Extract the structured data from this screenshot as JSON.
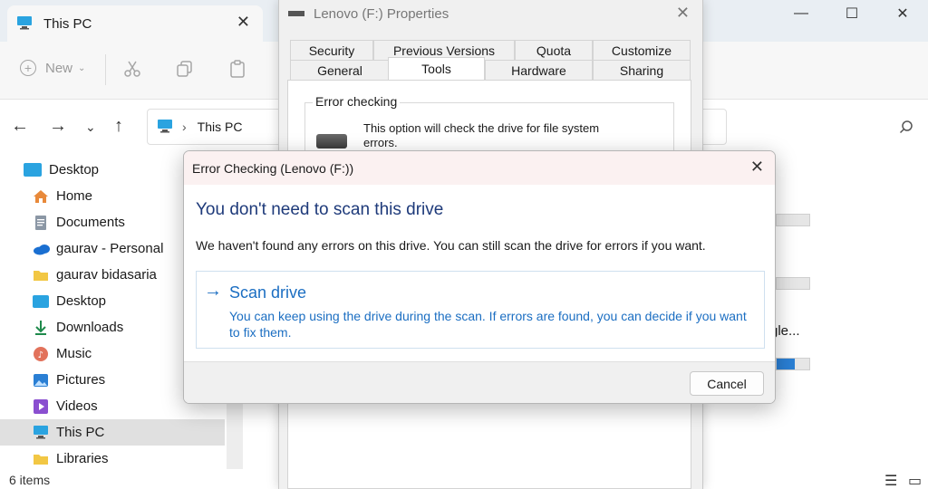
{
  "explorer": {
    "tab_title": "This PC",
    "toolbar": {
      "new_label": "New"
    },
    "breadcrumb": [
      "This PC"
    ],
    "sidebar": [
      {
        "label": "Desktop",
        "icon": "desktop-icon"
      },
      {
        "label": "Home",
        "icon": "home-icon"
      },
      {
        "label": "Documents",
        "icon": "documents-icon"
      },
      {
        "label": "gaurav - Personal",
        "icon": "onedrive-icon"
      },
      {
        "label": "gaurav bidasaria",
        "icon": "folder-icon"
      },
      {
        "label": "Desktop",
        "icon": "desktop-icon"
      },
      {
        "label": "Downloads",
        "icon": "downloads-icon"
      },
      {
        "label": "Music",
        "icon": "music-icon"
      },
      {
        "label": "Pictures",
        "icon": "pictures-icon"
      },
      {
        "label": "Videos",
        "icon": "videos-icon"
      },
      {
        "label": "This PC",
        "icon": "this-pc-icon",
        "selected": true
      },
      {
        "label": "Libraries",
        "icon": "folder-icon"
      }
    ],
    "status": "6 items",
    "partial_drive_label": "gle...",
    "drive_usage_fill": 0.55
  },
  "properties": {
    "title": "Lenovo (F:) Properties",
    "tabs_row1": [
      "Security",
      "Previous Versions",
      "Quota",
      "Customize"
    ],
    "tabs_row2": [
      "General",
      "Tools",
      "Hardware",
      "Sharing"
    ],
    "active_tab": "Tools",
    "error_group_label": "Error checking",
    "error_group_text": "This option will check the drive for file system errors."
  },
  "dialog": {
    "title": "Error Checking (Lenovo (F:))",
    "heading": "You don't need to scan this drive",
    "description": "We haven't found any errors on this drive. You can still scan the drive for errors if you want.",
    "command_title": "Scan drive",
    "command_sub": "You can keep using the drive during the scan. If errors are found, you can decide if you want to fix them.",
    "cancel_label": "Cancel"
  },
  "colors": {
    "accent_blue": "#1b6ec2",
    "heading_blue": "#1e3a7a",
    "titlebar_pink": "#fbf1f1"
  }
}
